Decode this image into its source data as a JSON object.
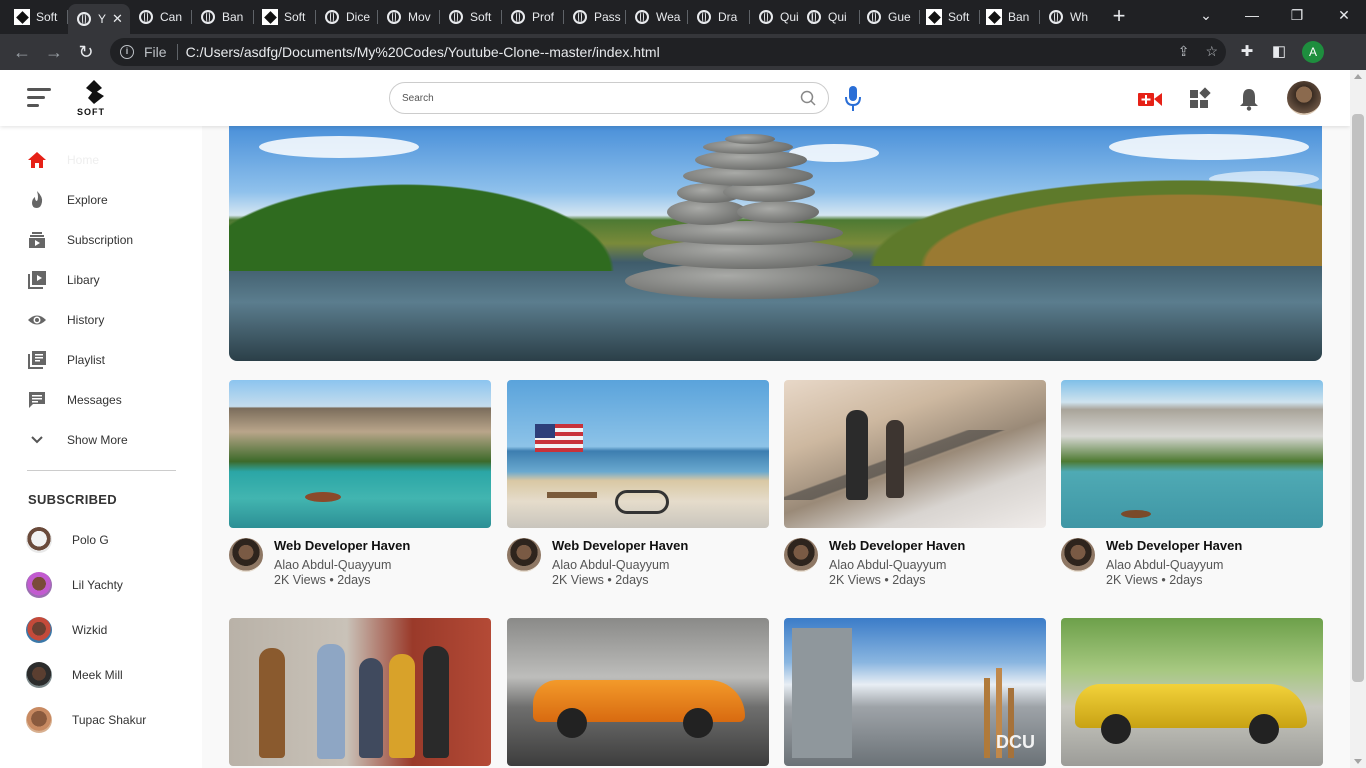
{
  "browser": {
    "tabs": [
      {
        "label": "Soft",
        "favicon": "soft-logo"
      },
      {
        "label": "Y",
        "favicon": "globe",
        "active": true
      },
      {
        "label": "Can",
        "favicon": "globe"
      },
      {
        "label": "Ban",
        "favicon": "globe"
      },
      {
        "label": "Soft",
        "favicon": "soft-logo"
      },
      {
        "label": "Dice",
        "favicon": "globe"
      },
      {
        "label": "Mov",
        "favicon": "globe"
      },
      {
        "label": "Soft",
        "favicon": "globe"
      },
      {
        "label": "Prof",
        "favicon": "globe"
      },
      {
        "label": "Pass",
        "favicon": "globe"
      },
      {
        "label": "Wea",
        "favicon": "globe"
      },
      {
        "label": "Dra",
        "favicon": "globe"
      },
      {
        "label": "Qui",
        "favicon": "globe"
      },
      {
        "label": "Qui",
        "favicon": "globe"
      },
      {
        "label": "Gue",
        "favicon": "globe"
      },
      {
        "label": "Soft",
        "favicon": "soft-logo"
      },
      {
        "label": "Ban",
        "favicon": "soft-logo"
      },
      {
        "label": "Wh",
        "favicon": "globe"
      }
    ],
    "address": {
      "scheme_label": "File",
      "url": "C:/Users/asdfg/Documents/My%20Codes/Youtube-Clone--master/index.html"
    },
    "profile_initial": "A"
  },
  "header": {
    "logo_text": "SOFT",
    "search_placeholder": "Search"
  },
  "sidebar": {
    "items": [
      {
        "label": "Home",
        "icon": "home-icon"
      },
      {
        "label": "Explore",
        "icon": "explore-icon"
      },
      {
        "label": "Subscription",
        "icon": "subscription-icon"
      },
      {
        "label": "Libary",
        "icon": "library-icon"
      },
      {
        "label": "History",
        "icon": "history-icon"
      },
      {
        "label": "Playlist",
        "icon": "playlist-icon"
      },
      {
        "label": "Messages",
        "icon": "messages-icon"
      },
      {
        "label": "Show More",
        "icon": "chevron-down-icon"
      }
    ],
    "subscribed_heading": "SUBSCRIBED",
    "subscribed": [
      {
        "name": "Polo G"
      },
      {
        "name": "Lil Yachty"
      },
      {
        "name": "Wizkid"
      },
      {
        "name": "Meek Mill"
      },
      {
        "name": "Tupac Shakur"
      }
    ]
  },
  "videos": [
    {
      "title": "Web Developer Haven",
      "channel": "Alao Abdul-Quayyum",
      "stats": "2K Views • 2days"
    },
    {
      "title": "Web Developer Haven",
      "channel": "Alao Abdul-Quayyum",
      "stats": "2K Views • 2days"
    },
    {
      "title": "Web Developer Haven",
      "channel": "Alao Abdul-Quayyum",
      "stats": "2K Views • 2days"
    },
    {
      "title": "Web Developer Haven",
      "channel": "Alao Abdul-Quayyum",
      "stats": "2K Views • 2days"
    }
  ],
  "thumbnail_text": {
    "dcu": "DCU"
  },
  "colors": {
    "accent_red": "#e62117",
    "mic_blue": "#2a6ed6"
  }
}
